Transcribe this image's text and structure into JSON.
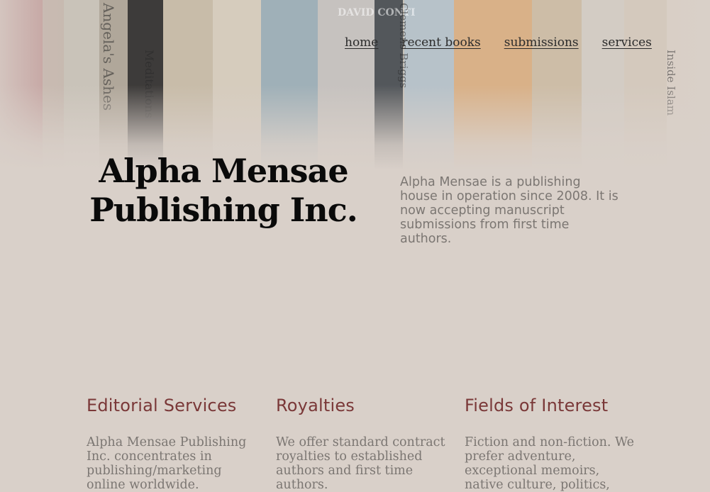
{
  "nav": {
    "home": "home",
    "recent_books": "recent books",
    "submissions": "submissions",
    "services": "services"
  },
  "hero": {
    "spine_texts": [
      "Angela's Ashes",
      "Meditations",
      "DAVID CONTI",
      "Clemens Briggs",
      "Inside Islam"
    ]
  },
  "site": {
    "title_line1": "Alpha Mensae",
    "title_line2": "Publishing Inc.",
    "intro": "Alpha Mensae is a publishing house in operation since 2008. It is now accepting manuscript submissions from first time authors."
  },
  "sections": [
    {
      "heading": "Editorial Services",
      "body": "Alpha Mensae Publishing Inc. concentrates in publishing/marketing online worldwide."
    },
    {
      "heading": "Royalties",
      "body": "We offer standard contract royalties to established authors and first time authors."
    },
    {
      "heading": "Fields of Interest",
      "body": "Fiction and non-fiction. We prefer adventure, exceptional memoirs, native culture, politics, science fiction, fantasy"
    }
  ],
  "colors": {
    "background": "#d9d0c9",
    "heading_accent": "#7a3838",
    "body_text": "#7b7672",
    "title": "#0a0a0a"
  }
}
